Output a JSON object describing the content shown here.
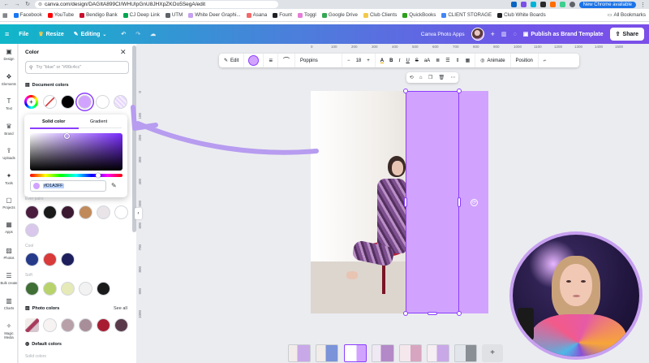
{
  "browser": {
    "url": "canva.com/design/DAGItA899CI/WHUIpGnU8JHXpZKOo5SegA/edit",
    "update_label": "New Chrome available",
    "all_bookmarks": "All Bookmarks"
  },
  "bookmarks": [
    {
      "label": "Facebook",
      "color": "#1877f2"
    },
    {
      "label": "YouTube",
      "color": "#ff0000"
    },
    {
      "label": "Bendigo Bank",
      "color": "#c8102e"
    },
    {
      "label": "CJ Deep Link",
      "color": "#00a651"
    },
    {
      "label": "UTM",
      "color": "#5f6368"
    },
    {
      "label": "White Deer Graphi...",
      "color": "#c7a0f0"
    },
    {
      "label": "Asana",
      "color": "#f06a6a"
    },
    {
      "label": "Fount",
      "color": "#202124"
    },
    {
      "label": "Toggl",
      "color": "#e57cd8"
    },
    {
      "label": "Google Drive",
      "color": "#34a853"
    },
    {
      "label": "Club Clients",
      "color": "#f2c94c"
    },
    {
      "label": "QuickBooks",
      "color": "#2ca01c"
    },
    {
      "label": "CLIENT STORAGE",
      "color": "#4285f4"
    },
    {
      "label": "Club White Boards",
      "color": "#202124"
    }
  ],
  "topbar": {
    "file": "File",
    "resize": "Resize",
    "editing": "Editing",
    "project_name": "Canva Photo Apps",
    "publish": "Publish as Brand Template",
    "share": "Share"
  },
  "rail": [
    "Design",
    "Elements",
    "Text",
    "Brand",
    "Uploads",
    "Tools",
    "Projects",
    "Apps",
    "Photos",
    "Bulk create",
    "Charts",
    "Magic Media"
  ],
  "panel": {
    "title": "Color",
    "search_placeholder": "Try \"blue\" or \"#00c4cc\"",
    "document_colors": "Document colors",
    "doc_swatches": [
      "#ffffff",
      "#000000",
      "#d1a3ff"
    ],
    "picker": {
      "tab_solid": "Solid color",
      "tab_gradient": "Gradient",
      "hex_value": "#D1A3FF",
      "hex_color": "#d1a3ff"
    },
    "palette_label": "Ever pairs",
    "palette1": [
      "#4a1d3f",
      "#1a1a1a",
      "#3b1930",
      "#c08a5a",
      "#e8e4e8",
      "#ffffff",
      "#d9c7ec"
    ],
    "palette2_label": "Cool",
    "palette2": [
      "#263a8a",
      "#d93a3a",
      "#1c1f5c"
    ],
    "palette3_label": "Soft",
    "palette3": [
      "#3f6f35",
      "#b8d36b",
      "#e6eab8",
      "#f2f2f2",
      "#1a1a1a"
    ],
    "photo_colors": "Photo colors",
    "see_all": "See all",
    "photo_swatches": [
      "#f7f3f2",
      "#b8a0a8",
      "#a88e98",
      "#a81c32",
      "#5a3a4a"
    ],
    "default_colors": "Default colors",
    "solid_colors": "Solid colors"
  },
  "toolbar": {
    "edit": "Edit",
    "font": "Poppins",
    "font_size": "18",
    "animate": "Animate",
    "position": "Position"
  },
  "ruler_top": [
    "0",
    "100",
    "200",
    "300",
    "400",
    "500",
    "600",
    "700",
    "800",
    "900",
    "1000",
    "1100",
    "1200",
    "1300",
    "1400",
    "1500"
  ],
  "ruler_left": [
    "0",
    "100",
    "200",
    "300",
    "400",
    "500",
    "600",
    "700",
    "800",
    "900",
    "1000"
  ],
  "selected_rect_color": "#d1a3ff"
}
